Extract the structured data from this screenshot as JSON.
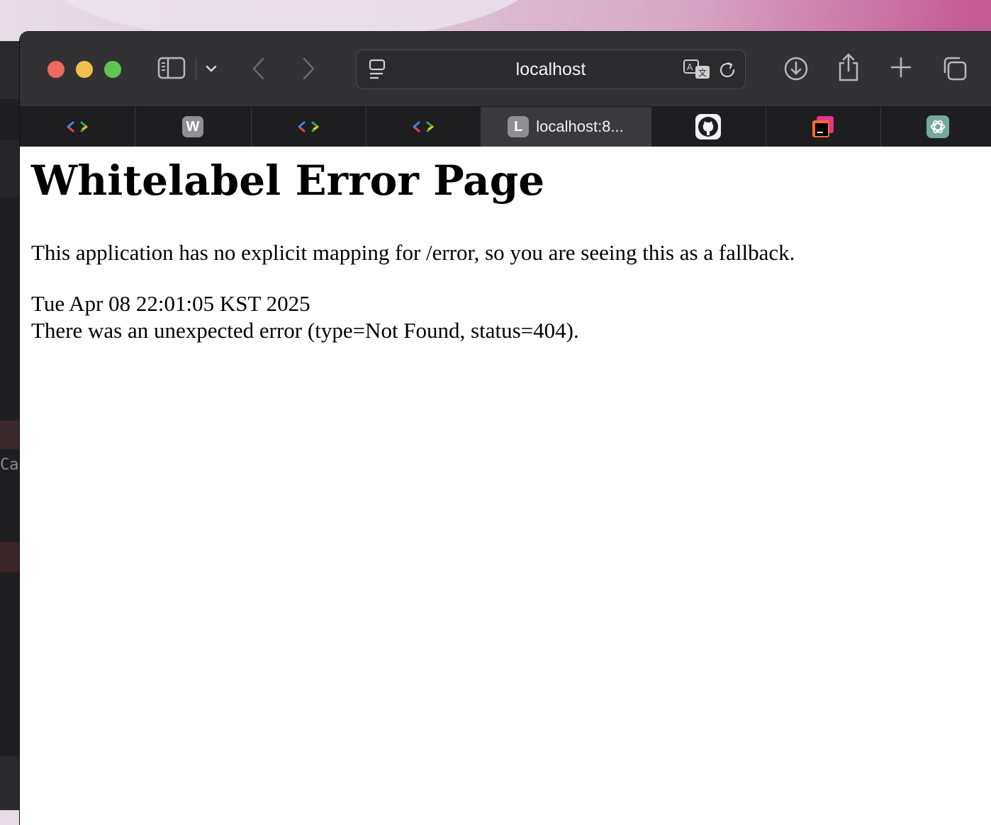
{
  "browser": {
    "url_display": "localhost",
    "tabs": [
      {
        "icon": "code-brackets-icon",
        "label": ""
      },
      {
        "icon": "letter-w-icon",
        "letter": "W",
        "label": ""
      },
      {
        "icon": "code-brackets-icon",
        "label": ""
      },
      {
        "icon": "code-brackets-icon",
        "label": ""
      },
      {
        "icon": "letter-l-icon",
        "letter": "L",
        "label": "localhost:8...",
        "active": true
      },
      {
        "icon": "github-icon",
        "label": ""
      },
      {
        "icon": "jetbrains-icon",
        "label": ""
      },
      {
        "icon": "chatgpt-icon",
        "label": ""
      }
    ],
    "colors": {
      "close": "#ed6a5e",
      "minimize": "#f4bf4f",
      "zoom": "#61c554"
    }
  },
  "page": {
    "title": "Whitelabel Error Page",
    "message": "This application has no explicit mapping for /error, so you are seeing this as a fallback.",
    "timestamp": "Tue Apr 08 22:01:05 KST 2025",
    "error": "There was an unexpected error (type=Not Found, status=404)."
  },
  "background_app": {
    "visible_text": "Ca"
  }
}
